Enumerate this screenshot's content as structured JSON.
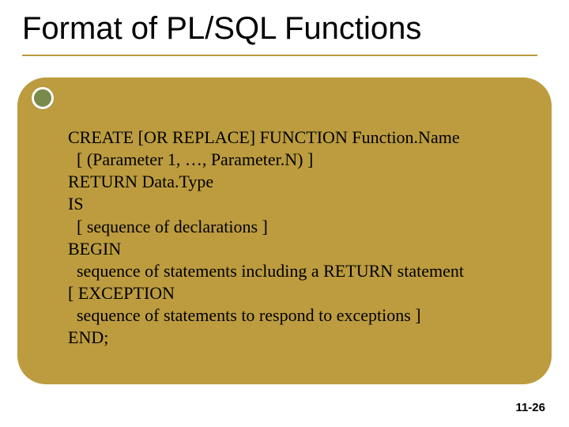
{
  "title": "Format of PL/SQL Functions",
  "code_lines": [
    "CREATE [OR REPLACE] FUNCTION Function.Name",
    "  [ (Parameter 1, …, Parameter.N) ]",
    "RETURN Data.Type",
    "IS",
    "  [ sequence of declarations ]",
    "BEGIN",
    "  sequence of statements including a RETURN statement",
    "[ EXCEPTION",
    "  sequence of statements to respond to exceptions ]",
    "END;"
  ],
  "page_number": "11-26"
}
